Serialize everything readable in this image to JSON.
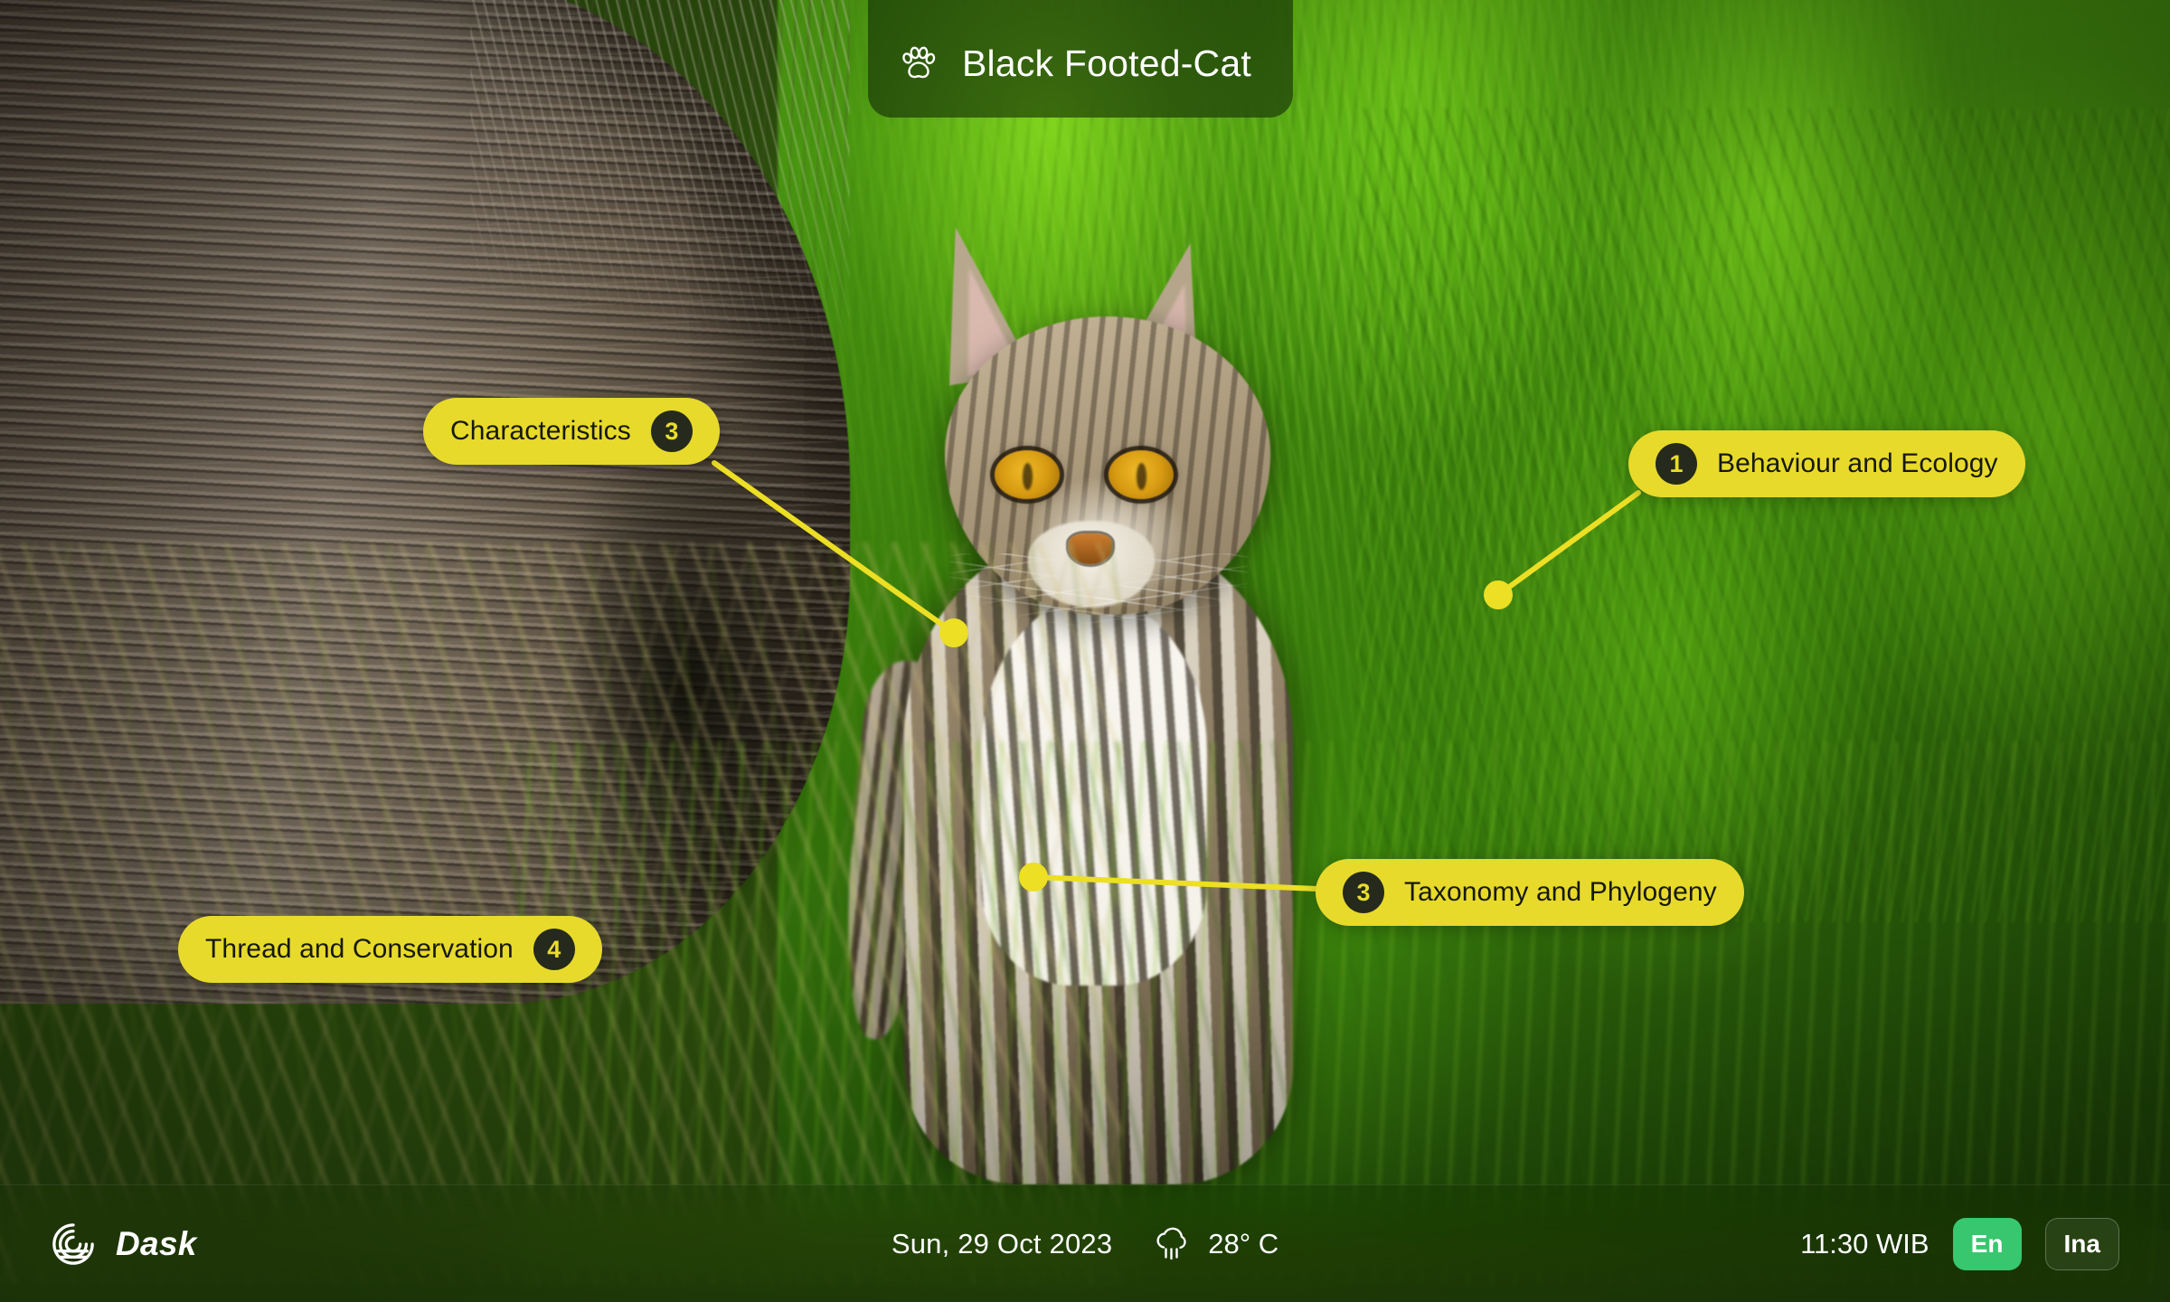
{
  "header": {
    "paw_icon": "paw-icon",
    "title": "Black Footed-Cat"
  },
  "annotations": [
    {
      "id": "characteristics",
      "label": "Characteristics",
      "number": "3",
      "badge_side": "right"
    },
    {
      "id": "behaviour",
      "label": "Behaviour and Ecology",
      "number": "1",
      "badge_side": "left"
    },
    {
      "id": "taxonomy",
      "label": "Taxonomy and Phylogeny",
      "number": "3",
      "badge_side": "left"
    },
    {
      "id": "thread",
      "label": "Thread and Conservation",
      "number": "4",
      "badge_side": "right"
    }
  ],
  "taskbar": {
    "brand": "Dask",
    "brand_icon": "dask-spiral-logo-icon",
    "date": "Sun, 29 Oct 2023",
    "weather_icon": "rain-cloud-icon",
    "temperature": "28° C",
    "time": "11:30 WIB",
    "languages": [
      {
        "label": "En",
        "active": true
      },
      {
        "label": "Ina",
        "active": false
      }
    ]
  },
  "colors": {
    "pill_yellow": "#e7da2b",
    "badge_dark": "#252a1d",
    "accent_green": "#38c76f",
    "connector_yellow": "#ecdf24"
  }
}
